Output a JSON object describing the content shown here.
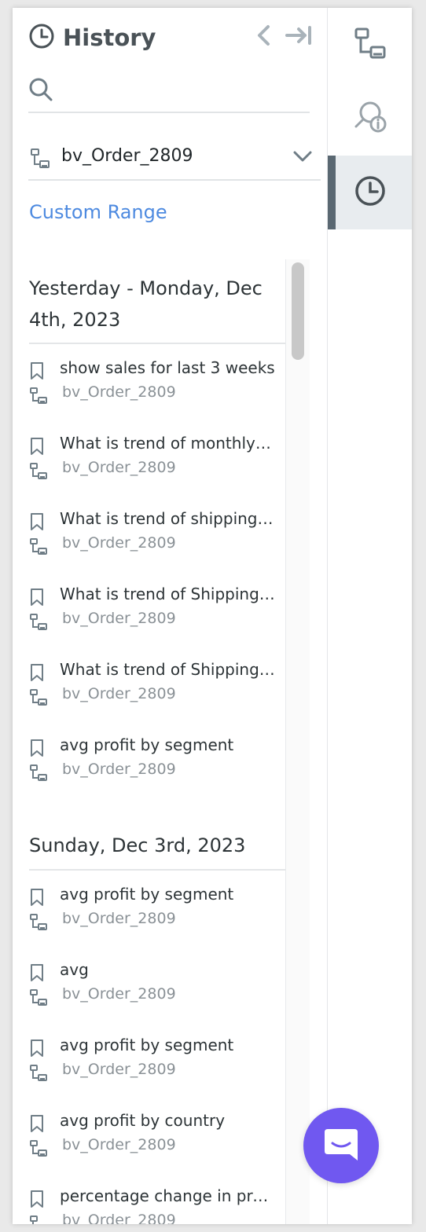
{
  "header": {
    "title": "History",
    "clock_icon": "clock-icon",
    "back_icon": "chevron-left-icon",
    "collapse_icon": "collapse-right-icon"
  },
  "search": {
    "placeholder": "",
    "value": ""
  },
  "dataset_selector": {
    "selected": "bv_Order_2809"
  },
  "custom_range_label": "Custom Range",
  "groups": [
    {
      "title_line1": "Yesterday - Monday, Dec",
      "title_line2": "4th, 2023",
      "entries": [
        {
          "text": "show sales for last 3 weeks",
          "dataset": "bv_Order_2809"
        },
        {
          "text": "What is trend of monthly sales",
          "dataset": "bv_Order_2809"
        },
        {
          "text": "What is trend of shipping cost",
          "dataset": "bv_Order_2809"
        },
        {
          "text": "What is trend of Shipping cost",
          "dataset": "bv_Order_2809"
        },
        {
          "text": "What is trend of Shipping cost by",
          "dataset": "bv_Order_2809"
        },
        {
          "text": "avg profit by segment",
          "dataset": "bv_Order_2809"
        }
      ]
    },
    {
      "title_line1": "Sunday, Dec 3rd, 2023",
      "entries": [
        {
          "text": "avg profit by segment",
          "dataset": "bv_Order_2809"
        },
        {
          "text": "avg",
          "dataset": "bv_Order_2809"
        },
        {
          "text": "avg profit by segment",
          "dataset": "bv_Order_2809"
        },
        {
          "text": "avg profit by country",
          "dataset": "bv_Order_2809"
        },
        {
          "text": "percentage change in profit",
          "dataset": "bv_Order_2809"
        }
      ]
    }
  ],
  "rail": [
    {
      "icon": "dataset-icon",
      "active": false
    },
    {
      "icon": "search-info-icon",
      "active": false
    },
    {
      "icon": "history-clock-icon",
      "active": true
    }
  ],
  "colors": {
    "accent_link": "#4d8ae0",
    "fab": "#7058f0",
    "rail_active_bar": "#5a6872"
  }
}
